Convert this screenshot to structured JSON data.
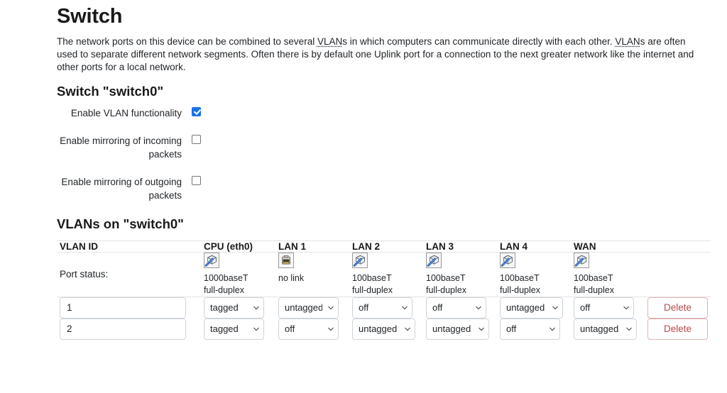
{
  "page": {
    "title": "Switch",
    "description_parts": {
      "p1": "The network ports on this device can be combined to several ",
      "abbr1": "VLAN",
      "p2": "s in which computers can communicate directly with each other. ",
      "abbr2": "VLAN",
      "p3": "s are often used to separate different network segments. Often there is by default one Uplink port for a connection to the next greater network like the internet and other ports for a local network."
    },
    "description_full": "The network ports on this device can be combined to several VLANs in which computers can communicate directly with each other. VLANs are often used to separate different network segments. Often there is by default one Uplink port for a connection to the next greater network like the internet and other ports for a local network."
  },
  "switch_section": {
    "title": "Switch \"switch0\"",
    "options": [
      {
        "label": "Enable VLAN functionality",
        "checked": true
      },
      {
        "label": "Enable mirroring of incoming packets",
        "checked": false
      },
      {
        "label": "Enable mirroring of outgoing packets",
        "checked": false
      }
    ]
  },
  "vlan_section": {
    "title": "VLANs on \"switch0\"",
    "columns": [
      "VLAN ID",
      "CPU (eth0)",
      "LAN 1",
      "LAN 2",
      "LAN 3",
      "LAN 4",
      "WAN"
    ],
    "port_status_label": "Port status:",
    "port_status": [
      {
        "icon": "ethernet-connected-icon",
        "speed": "1000baseT",
        "duplex": "full-duplex"
      },
      {
        "icon": "ethernet-nolink-icon",
        "speed": "no link",
        "duplex": ""
      },
      {
        "icon": "ethernet-connected-icon",
        "speed": "100baseT",
        "duplex": "full-duplex"
      },
      {
        "icon": "ethernet-connected-icon",
        "speed": "100baseT",
        "duplex": "full-duplex"
      },
      {
        "icon": "ethernet-connected-icon",
        "speed": "100baseT",
        "duplex": "full-duplex"
      },
      {
        "icon": "ethernet-connected-icon",
        "speed": "100baseT",
        "duplex": "full-duplex"
      }
    ],
    "select_options": [
      "off",
      "untagged",
      "tagged"
    ],
    "delete_label": "Delete",
    "rows": [
      {
        "vlan_id": "1",
        "ports": [
          "tagged",
          "untagged",
          "off",
          "off",
          "untagged",
          "off"
        ]
      },
      {
        "vlan_id": "2",
        "ports": [
          "tagged",
          "off",
          "untagged",
          "untagged",
          "off",
          "untagged"
        ]
      }
    ]
  },
  "colors": {
    "checkbox_accent": "#1a73e8",
    "delete_text": "#b94a48",
    "delete_border": "#e2b3b3",
    "border": "#e4e4e4",
    "input_border": "#ced4da",
    "text": "#212529"
  }
}
